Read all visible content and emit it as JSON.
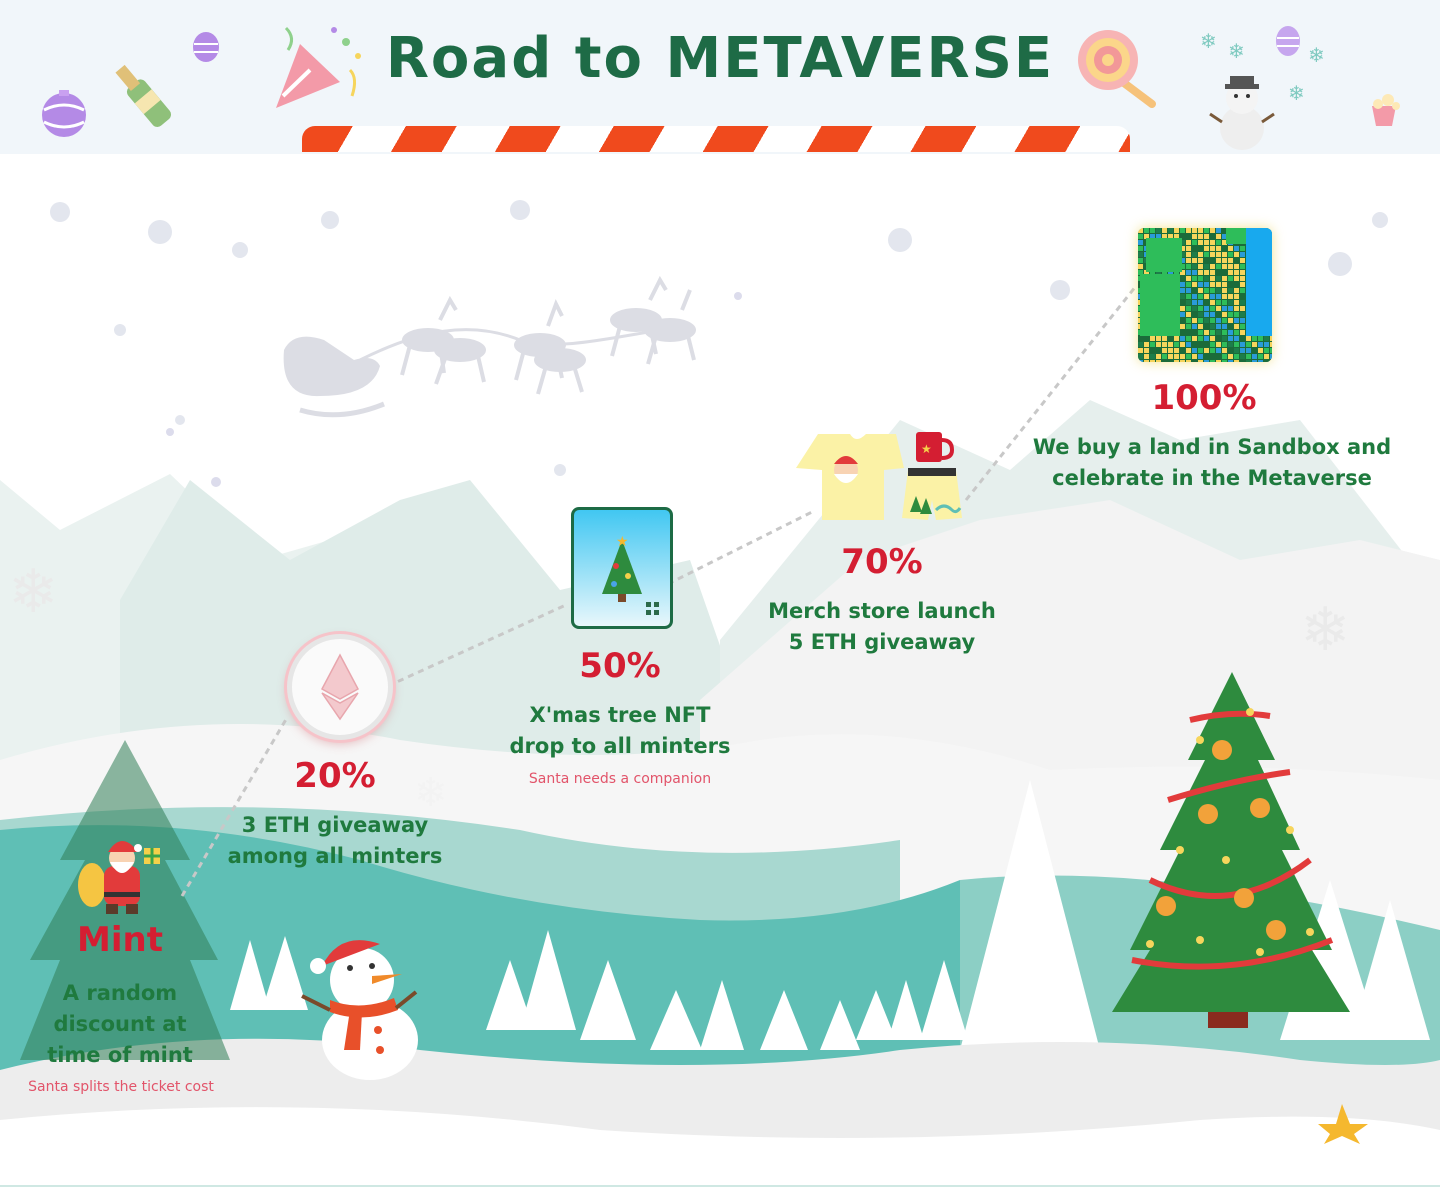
{
  "header": {
    "title": "Road to METAVERSE"
  },
  "roadmap": {
    "mint": {
      "title": "Mint",
      "description_lines": [
        "A random",
        "discount at",
        "time of mint"
      ],
      "note": "Santa splits the ticket cost"
    },
    "m20": {
      "percent": "20%",
      "description_lines": [
        "3 ETH giveaway",
        "among all minters"
      ]
    },
    "m50": {
      "percent": "50%",
      "description_lines": [
        "X'mas tree NFT",
        "drop to all minters"
      ],
      "note": "Santa needs a companion"
    },
    "m70": {
      "percent": "70%",
      "description_lines": [
        "Merch store launch",
        "5 ETH giveaway"
      ]
    },
    "m100": {
      "percent": "100%",
      "description_lines": [
        "We buy a land in Sandbox and",
        "celebrate in the Metaverse"
      ]
    }
  },
  "colors": {
    "title_green": "#1e6b46",
    "percent_red": "#d41e32",
    "description_green": "#1f7a3e",
    "note_pink": "#e2546a",
    "candy_red": "#f04a1d",
    "hill_teal": "#5fbfb5"
  },
  "icons": [
    "ethereum-icon",
    "christmas-tree-icon",
    "qr-code-icon",
    "t-shirt-icon",
    "mug-icon",
    "shorts-icon",
    "santa-icon",
    "snowman-icon",
    "sleigh-icon",
    "star-icon",
    "lollipop-icon",
    "champagne-icon",
    "party-popper-icon",
    "ornament-icon",
    "snowflake-icon"
  ]
}
